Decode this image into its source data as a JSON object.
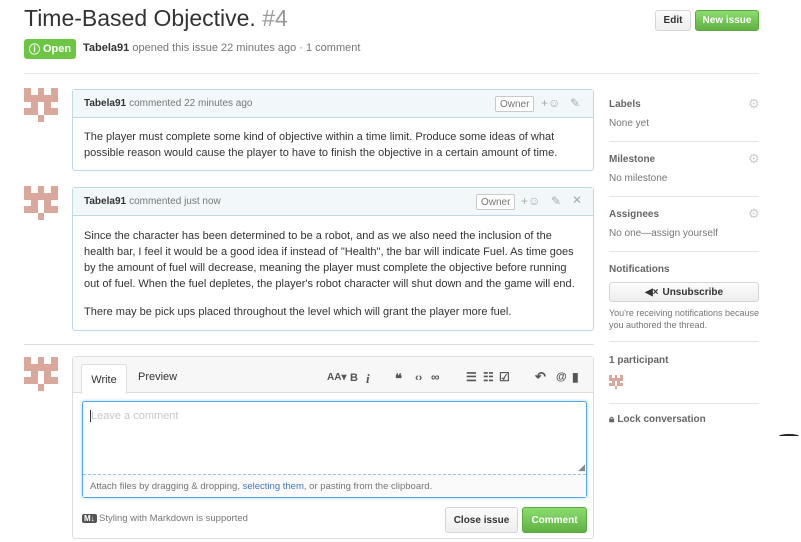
{
  "header": {
    "title": "Time-Based Objective.",
    "number": "#4",
    "edit_label": "Edit",
    "new_issue_label": "New issue"
  },
  "state": {
    "label": "Open",
    "color": "#6cc644"
  },
  "meta": {
    "author": "Tabela91",
    "text": "opened this issue 22 minutes ago · 1 comment"
  },
  "comments": [
    {
      "author": "Tabela91",
      "time": "commented 22 minutes ago",
      "badge": "Owner",
      "paragraphs": [
        "The player must complete some kind of objective within a time limit. Produce some ideas of what possible reason would cause the player to have to finish the objective in a certain amount of time."
      ]
    },
    {
      "author": "Tabela91",
      "time": "commented just now",
      "badge": "Owner",
      "paragraphs": [
        "Since the character has been determined to be a robot, and as we also need the inclusion of the health bar, I feel it would be a good idea if instead of \"Health\", the bar will indicate Fuel. As time goes by the amount of fuel will decrease, meaning the player must complete the objective before running out of fuel. When the fuel depletes, the player's robot character will shut down and the game will end.",
        "There may be pick ups placed throughout the level which will grant the player more fuel."
      ]
    }
  ],
  "editor": {
    "tab_write": "Write",
    "tab_preview": "Preview",
    "tool_heading": "AA▾",
    "tool_bold": "B",
    "tool_italic": "i",
    "placeholder": "Leave a comment",
    "attach_prefix": "Attach files by dragging & dropping, ",
    "attach_link": "selecting them",
    "attach_suffix": ", or pasting from the clipboard.",
    "markdown_note": "Styling with Markdown is supported",
    "close_label": "Close issue",
    "comment_label": "Comment"
  },
  "sidebar": {
    "labels": {
      "heading": "Labels",
      "value": "None yet"
    },
    "milestone": {
      "heading": "Milestone",
      "value": "No milestone"
    },
    "assignees": {
      "heading": "Assignees",
      "value": "No one—assign yourself"
    },
    "notifications": {
      "heading": "Notifications",
      "button": "Unsubscribe",
      "note": "You're receiving notifications because you authored the thread."
    },
    "participants": {
      "heading": "1 participant"
    },
    "lock": {
      "label": "Lock conversation"
    }
  },
  "colors": {
    "accent": "#4078c0",
    "green": "#6cc644",
    "avatar": "#d9a79b"
  }
}
